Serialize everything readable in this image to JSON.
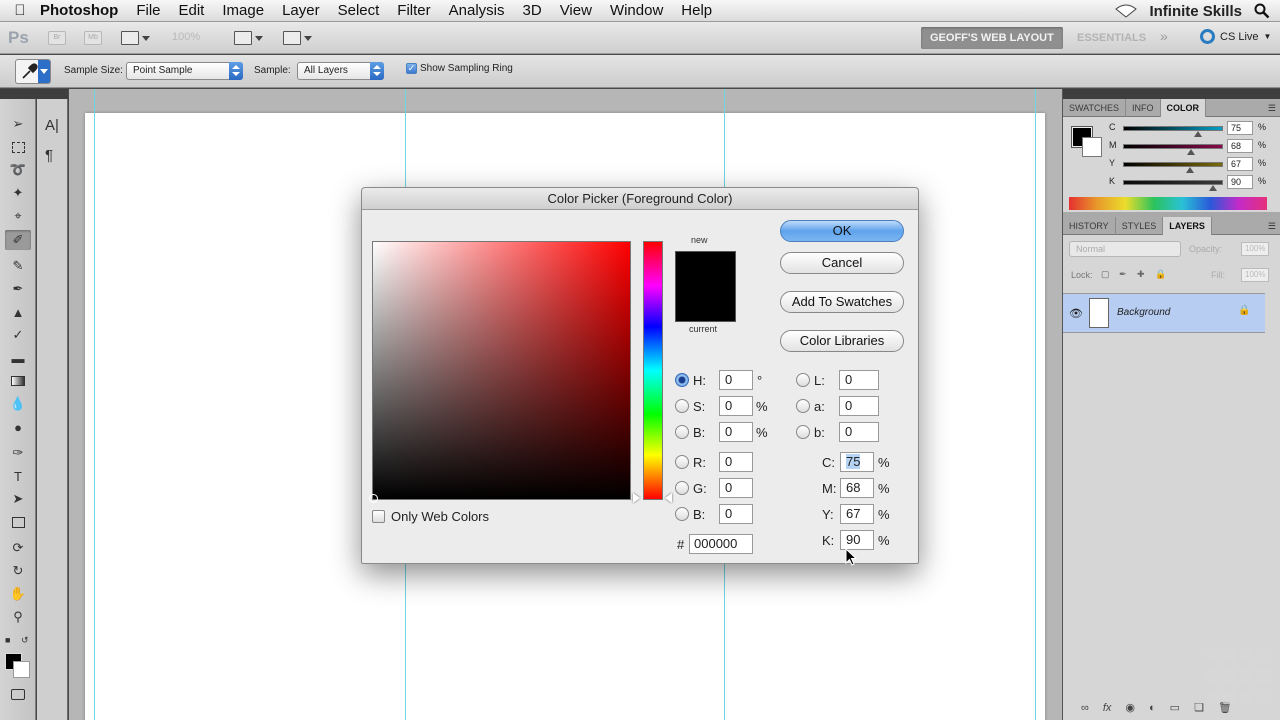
{
  "menubar": {
    "app_name": "Photoshop",
    "items": [
      "File",
      "Edit",
      "Image",
      "Layer",
      "Select",
      "Filter",
      "Analysis",
      "3D",
      "View",
      "Window",
      "Help"
    ],
    "right_brand": "Infinite Skills"
  },
  "appbar": {
    "logo": "Ps",
    "mini_br": "Br",
    "mini_mb": "Mb",
    "zoom": "100%",
    "workspace_active": "GEOFF'S WEB LAYOUT",
    "workspace_inactive": "ESSENTIALS",
    "more": "»",
    "cs_live": "CS Live"
  },
  "optionsbar": {
    "sample_size_label": "Sample Size:",
    "sample_size_value": "Point Sample",
    "sample_label": "Sample:",
    "sample_value": "All Layers",
    "show_ring_label": "Show Sampling Ring",
    "show_ring_checked": true
  },
  "tools_panel": {
    "panel2_icons": [
      "A|",
      "¶"
    ]
  },
  "color_panel": {
    "tabs": [
      "SWATCHES",
      "INFO",
      "COLOR"
    ],
    "active_tab": "COLOR",
    "channels": [
      {
        "label": "C",
        "value": "75",
        "unit": "%",
        "level": 0.75
      },
      {
        "label": "M",
        "value": "68",
        "unit": "%",
        "level": 0.68
      },
      {
        "label": "Y",
        "value": "67",
        "unit": "%",
        "level": 0.67
      },
      {
        "label": "K",
        "value": "90",
        "unit": "%",
        "level": 0.9
      }
    ]
  },
  "layers_panel": {
    "tabs": [
      "HISTORY",
      "STYLES",
      "LAYERS"
    ],
    "active_tab": "LAYERS",
    "blend_mode": "Normal",
    "opacity_label": "Opacity:",
    "opacity_value": "100%",
    "lock_label": "Lock:",
    "fill_label": "Fill:",
    "fill_value": "100%",
    "layer_name": "Background"
  },
  "dialog": {
    "title": "Color Picker (Foreground Color)",
    "new_label": "new",
    "current_label": "current",
    "new_color": "#000000",
    "current_color": "#000000",
    "buttons": {
      "ok": "OK",
      "cancel": "Cancel",
      "add_swatches": "Add To Swatches",
      "color_libraries": "Color Libraries"
    },
    "only_web_colors": "Only Web Colors",
    "hsb": [
      {
        "label": "H:",
        "value": "0",
        "unit": "°",
        "selected": true
      },
      {
        "label": "S:",
        "value": "0",
        "unit": "%"
      },
      {
        "label": "B:",
        "value": "0",
        "unit": "%"
      }
    ],
    "rgb": [
      {
        "label": "R:",
        "value": "0"
      },
      {
        "label": "G:",
        "value": "0"
      },
      {
        "label": "B:",
        "value": "0"
      }
    ],
    "lab": [
      {
        "label": "L:",
        "value": "0"
      },
      {
        "label": "a:",
        "value": "0"
      },
      {
        "label": "b:",
        "value": "0"
      }
    ],
    "cmyk": [
      {
        "label": "C:",
        "value": "75",
        "unit": "%"
      },
      {
        "label": "M:",
        "value": "68",
        "unit": "%"
      },
      {
        "label": "Y:",
        "value": "67",
        "unit": "%"
      },
      {
        "label": "K:",
        "value": "90",
        "unit": "%"
      }
    ],
    "hex_label": "#",
    "hex_value": "000000"
  }
}
